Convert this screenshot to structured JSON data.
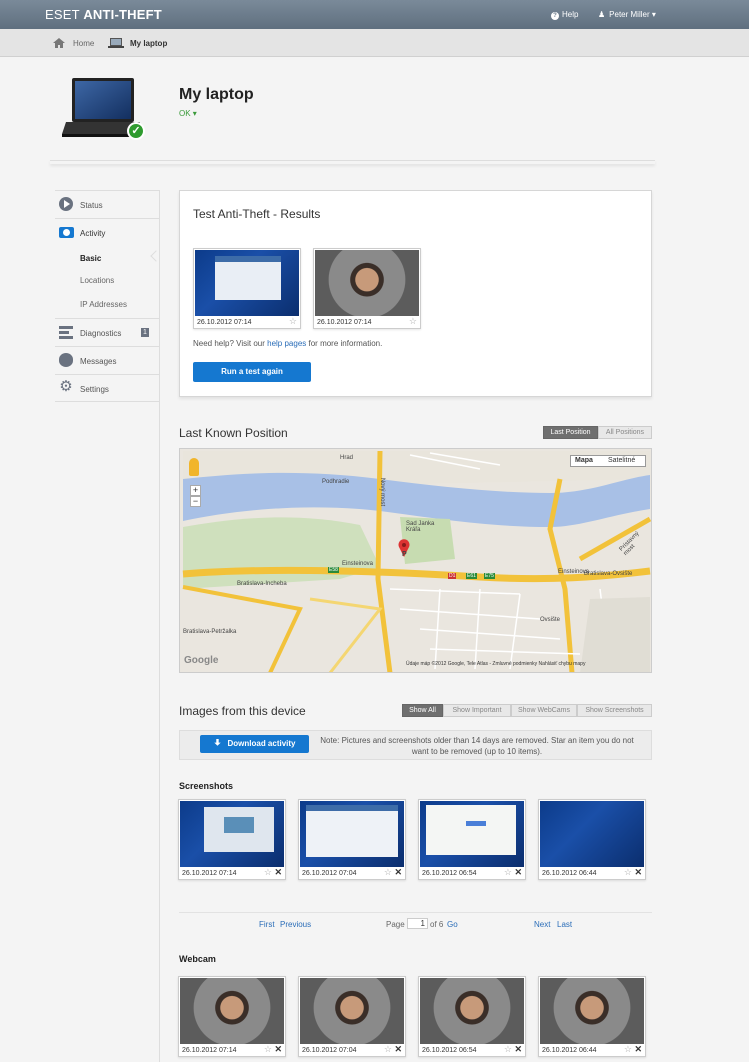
{
  "header": {
    "brand_light": "ESET ",
    "brand_bold": "ANTI-THEFT",
    "help": "Help",
    "user": "Peter Miller ▾"
  },
  "breadcrumb": {
    "home": "Home",
    "current": "My laptop"
  },
  "device": {
    "name": "My laptop",
    "status": "OK ▾"
  },
  "sidebar": {
    "items": [
      {
        "label": "Status"
      },
      {
        "label": "Activity"
      },
      {
        "label": "Diagnostics",
        "badge": "1"
      },
      {
        "label": "Messages"
      },
      {
        "label": "Settings"
      }
    ],
    "sub_items": [
      "Basic",
      "Locations",
      "IP Addresses"
    ]
  },
  "test_results": {
    "title": "Test Anti-Theft - Results",
    "thumbs": [
      "26.10.2012 07:14",
      "26.10.2012 07:14"
    ],
    "help_pre": "Need help? Visit our ",
    "help_link": "help pages",
    "help_post": " for more information.",
    "button": "Run a test again"
  },
  "position": {
    "title": "Last Known Position",
    "tab_last": "Last Position",
    "tab_all": "All Positions",
    "map_type_1": "Mapa",
    "map_type_2": "Satelitné",
    "attribution": "Údaje máp ©2012 Google, Tele Atlas - Zmluvné podmienky  Nahlásiť chybu mapy",
    "labels": [
      "Hrad",
      "Podhradie",
      "Nový most",
      "Sad Janka Kráľa",
      "Einsteinova",
      "Einsteinova",
      "Bratislava-Incheba",
      "Bratislava-Petržalka",
      "Ovsište",
      "P",
      "Prístavný most",
      "D1",
      "E75",
      "E58",
      "E61",
      "Bratislava-Ovsište"
    ]
  },
  "images": {
    "title": "Images from this device",
    "tabs": [
      "Show All",
      "Show Important",
      "Show WebCams",
      "Show Screenshots"
    ],
    "download": "Download activity",
    "note": "Note: Pictures and screenshots older than 14 days are removed. Star an item you do not want to be removed (up to 10 items)."
  },
  "screenshots": {
    "title": "Screenshots",
    "items": [
      "26.10.2012 07:14",
      "26.10.2012 07:04",
      "26.10.2012 06:54",
      "26.10.2012 06:44"
    ]
  },
  "pager": {
    "first": "First",
    "previous": "Previous",
    "page": "Page",
    "current": "1",
    "of": "of 6",
    "go": "Go",
    "next": "Next",
    "last": "Last"
  },
  "webcam": {
    "title": "Webcam",
    "items": [
      "26.10.2012 07:14",
      "26.10.2012 07:04",
      "26.10.2012 06:54",
      "26.10.2012 06:44"
    ]
  },
  "colors": {
    "accent": "#1578d0",
    "topbar": "#6b7b8b",
    "ok_green": "#3a9a3a",
    "link": "#2a6db8"
  }
}
